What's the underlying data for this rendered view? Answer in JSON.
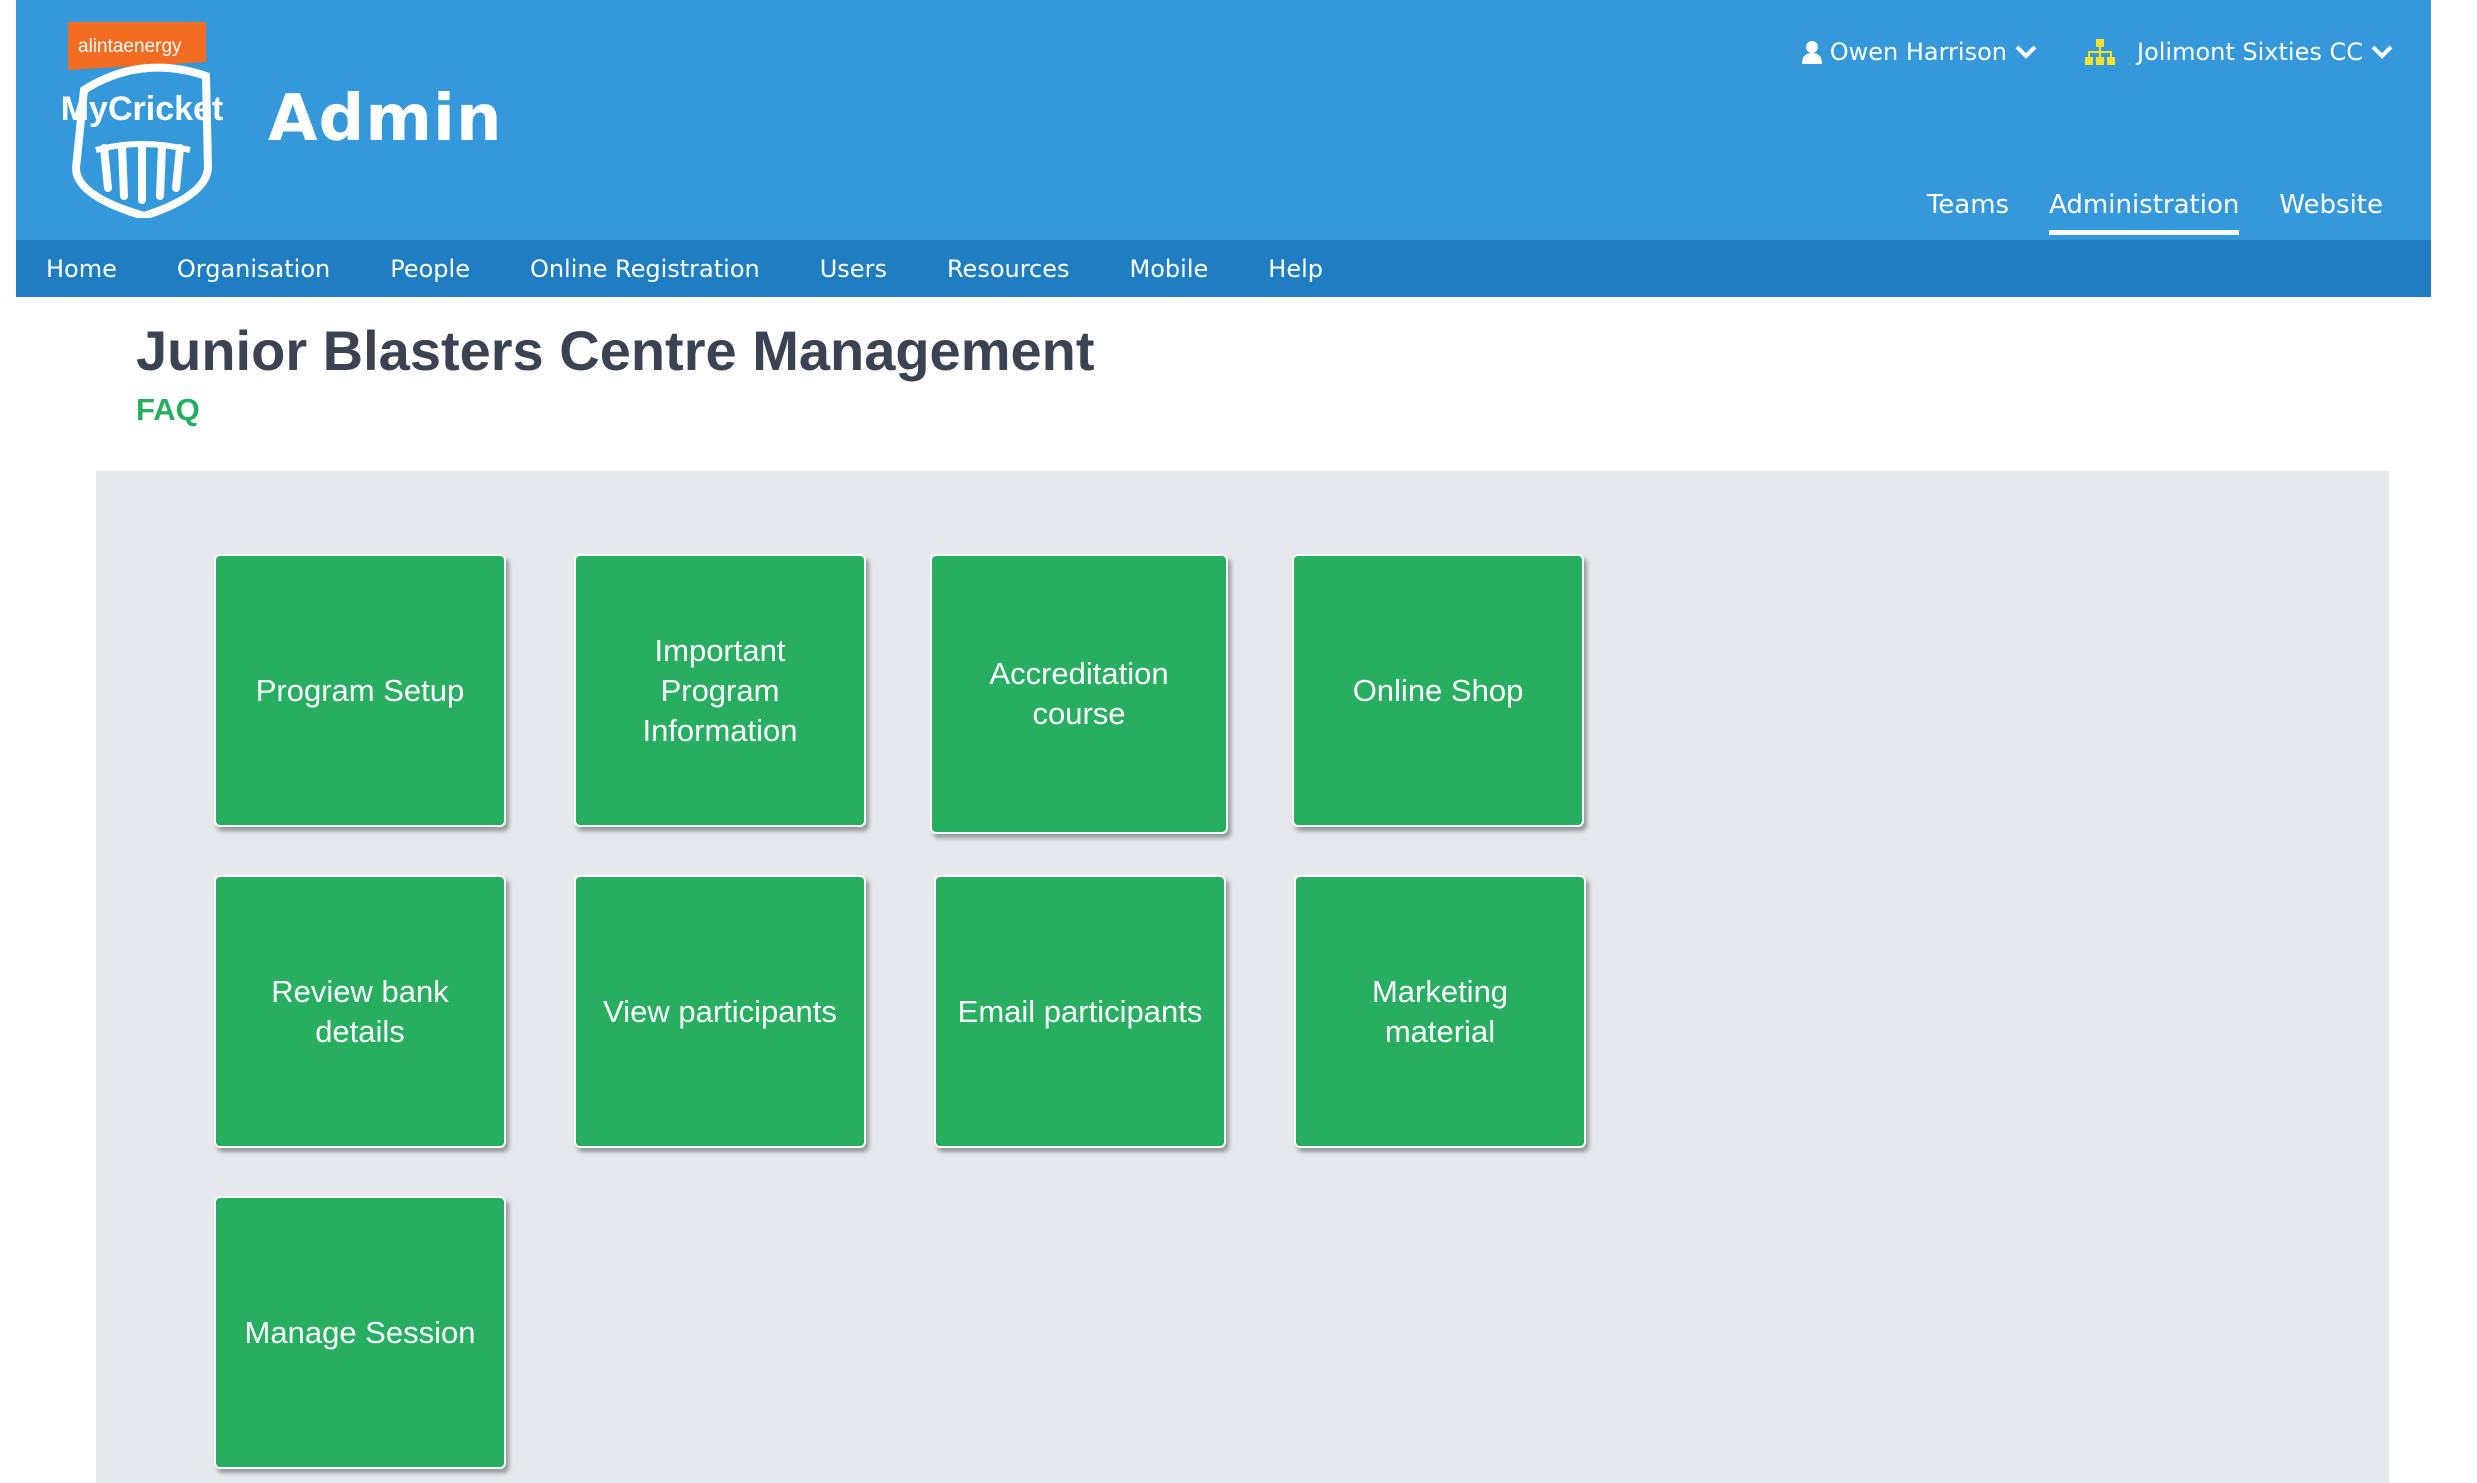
{
  "header": {
    "logo_sponsor": "alintaenergy",
    "logo_brand": "MyCricket",
    "title": "Admin",
    "user_name": "Owen Harrison",
    "club_name": "Jolimont Sixties CC",
    "app_tabs": [
      {
        "label": "Teams"
      },
      {
        "label": "Administration",
        "active": true
      },
      {
        "label": "Website"
      }
    ]
  },
  "nav": {
    "items": [
      {
        "label": "Home"
      },
      {
        "label": "Organisation"
      },
      {
        "label": "People"
      },
      {
        "label": "Online Registration"
      },
      {
        "label": "Users"
      },
      {
        "label": "Resources"
      },
      {
        "label": "Mobile"
      },
      {
        "label": "Help"
      }
    ]
  },
  "main": {
    "title": "Junior Blasters Centre Management",
    "faq_label": "FAQ",
    "tiles": [
      {
        "label": "Program Setup"
      },
      {
        "label": "Important Program Information"
      },
      {
        "label": "Accreditation course"
      },
      {
        "label": "Online Shop"
      },
      {
        "label": "Review bank details"
      },
      {
        "label": "View participants"
      },
      {
        "label": "Email participants"
      },
      {
        "label": "Marketing material"
      },
      {
        "label": "Manage Session"
      }
    ]
  },
  "colors": {
    "header_blue": "#3498db",
    "nav_blue": "#1f7ec2",
    "tile_green": "#27ae60",
    "title_gray": "#3b4352",
    "panel_gray": "#e5e8ec",
    "sponsor_orange": "#f26d21",
    "club_icon_yellow": "#f4e12a"
  }
}
